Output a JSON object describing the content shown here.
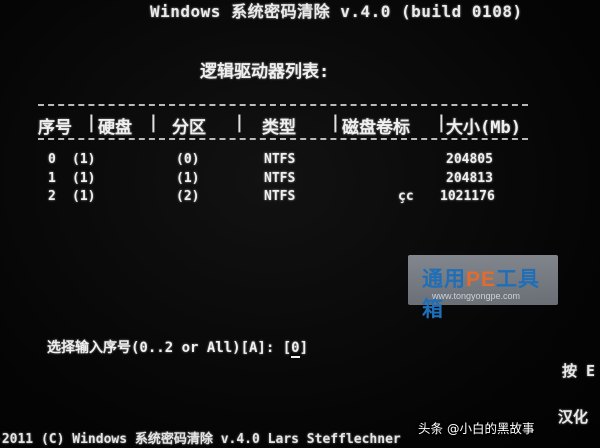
{
  "header": {
    "title": "Windows 系统密码清除 v.4.0 (build 0108)",
    "subtitle": "逻辑驱动器列表:"
  },
  "table": {
    "columns": [
      "序号",
      "硬盘",
      "分区",
      "类型",
      "磁盘卷标",
      "大小(Mb)"
    ],
    "rows": [
      {
        "index": "0",
        "disk": "(1)",
        "partition": "(0)",
        "type": "NTFS",
        "label": "",
        "size": "204805"
      },
      {
        "index": "1",
        "disk": "(1)",
        "partition": "(1)",
        "type": "NTFS",
        "label": "",
        "size": "204813"
      },
      {
        "index": "2",
        "disk": "(1)",
        "partition": "(2)",
        "type": "NTFS",
        "label": "çc",
        "size": "1021176"
      }
    ]
  },
  "watermark": {
    "brand_prefix": "通用",
    "brand_pe": "PE",
    "brand_suffix": "工具箱",
    "url": "www.tongyongpe.com"
  },
  "prompt": {
    "text": "选择输入序号(0..2 or All)[A]: [",
    "value": "0",
    "close": "]"
  },
  "side_text": {
    "key_hint": "按 E",
    "hanhua": "汉化"
  },
  "footer": {
    "text": "-2011 (C) Windows 系统密码清除 v.4.0 Lars Stefflechner"
  },
  "overlay": {
    "credit": "头条 @小白的黑故事"
  }
}
